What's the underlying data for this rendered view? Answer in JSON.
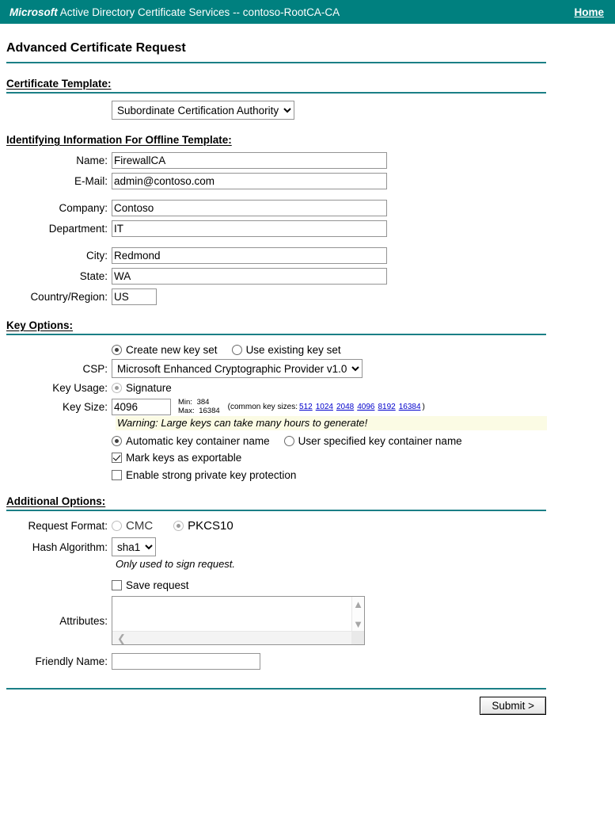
{
  "header": {
    "brand": "Microsoft",
    "title": " Active Directory Certificate Services  --  contoso-RootCA-CA",
    "home_label": "Home",
    "bar_color": "#00807f"
  },
  "page_title": "Advanced Certificate Request",
  "sections": {
    "certificate_template": {
      "heading": "Certificate Template:",
      "selected": "Subordinate Certification Authority"
    },
    "identifying_information": {
      "heading": "Identifying Information For Offline Template:",
      "fields": [
        {
          "label": "Name:",
          "value": "FirewallCA"
        },
        {
          "label": "E-Mail:",
          "value": "admin@contoso.com"
        },
        {
          "label": "Company:",
          "value": "Contoso"
        },
        {
          "label": "Department:",
          "value": "IT"
        },
        {
          "label": "City:",
          "value": "Redmond"
        },
        {
          "label": "State:",
          "value": "WA"
        },
        {
          "label": "Country/Region:",
          "value": "US"
        }
      ]
    },
    "key_options": {
      "heading": "Key Options:",
      "key_set_create_label": "Create new key set",
      "key_set_existing_label": "Use existing key set",
      "csp_label": "CSP:",
      "csp_selected": "Microsoft Enhanced Cryptographic Provider v1.0",
      "key_usage_label": "Key Usage:",
      "key_usage_signature_label": "Signature",
      "key_size_label": "Key Size:",
      "key_size_value": "4096",
      "min_label": "Min:",
      "min_value": "384",
      "max_label": "Max:",
      "max_value": "16384",
      "common_prefix": "(common key sizes:",
      "common_sizes": [
        "512",
        "1024",
        "2048",
        "4096",
        "8192",
        "16384"
      ],
      "common_suffix": ")",
      "warning": "Warning: Large keys can take many hours to generate!",
      "container_auto_label": "Automatic key container name",
      "container_user_label": "User specified key container name",
      "mark_exportable_label": "Mark keys as exportable",
      "strong_protection_label": "Enable strong private key protection"
    },
    "additional_options": {
      "heading": "Additional Options:",
      "request_format_label": "Request Format:",
      "format_cmc_label": "CMC",
      "format_pkcs10_label": "PKCS10",
      "hash_label": "Hash Algorithm:",
      "hash_selected": "sha1",
      "hash_note": "Only used to sign request.",
      "save_request_label": "Save request",
      "attributes_label": "Attributes:",
      "attributes_value": "",
      "friendly_name_label": "Friendly Name:",
      "friendly_name_value": ""
    }
  },
  "submit_label": "Submit >"
}
